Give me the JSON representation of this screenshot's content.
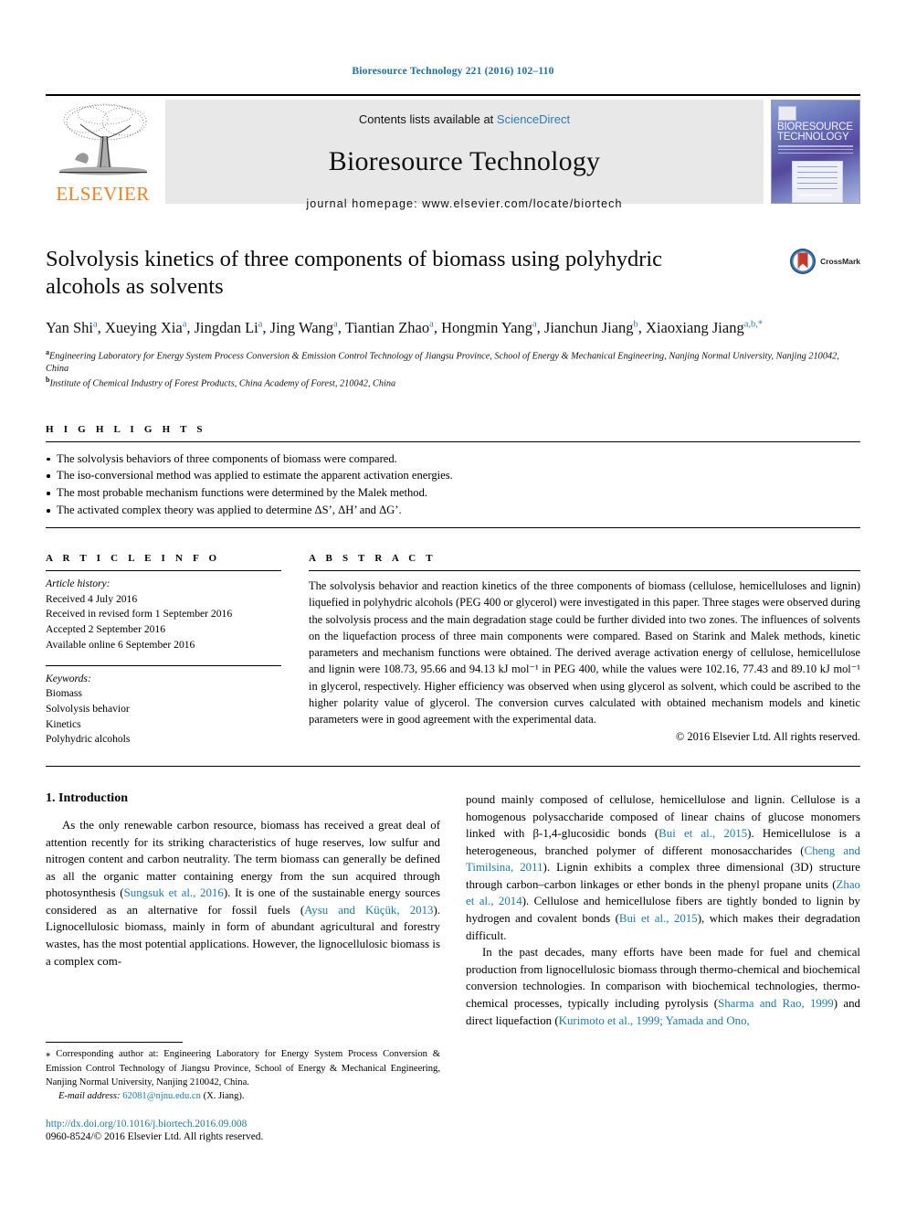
{
  "running_head": "Bioresource Technology 221 (2016) 102–110",
  "masthead": {
    "publisher": "ELSEVIER",
    "contents_prefix": "Contents lists available at ",
    "contents_link": "ScienceDirect",
    "journal_name": "Bioresource Technology",
    "homepage": "journal homepage: www.elsevier.com/locate/biortech",
    "cover_title_line1": "BIORESOURCE",
    "cover_title_line2": "TECHNOLOGY"
  },
  "article": {
    "title": "Solvolysis kinetics of three components of biomass using polyhydric alcohols as solvents",
    "crossmark_label": "CrossMark",
    "authors": [
      {
        "name": "Yan Shi",
        "sup": "a",
        "sep": ", "
      },
      {
        "name": "Xueying Xia",
        "sup": "a",
        "sep": ", "
      },
      {
        "name": "Jingdan Li",
        "sup": "a",
        "sep": ", "
      },
      {
        "name": "Jing Wang",
        "sup": "a",
        "sep": ", "
      },
      {
        "name": "Tiantian Zhao",
        "sup": "a",
        "sep": ", "
      },
      {
        "name": "Hongmin Yang",
        "sup": "a",
        "sep": ", "
      },
      {
        "name": "Jianchun Jiang",
        "sup": "b",
        "sep": ", "
      },
      {
        "name": "Xiaoxiang Jiang",
        "sup": "a,b,*",
        "sep": ""
      }
    ],
    "affiliations": [
      {
        "mark": "a",
        "text": "Engineering Laboratory for Energy System Process Conversion & Emission Control Technology of Jiangsu Province, School of Energy & Mechanical Engineering, Nanjing Normal University, Nanjing 210042, China"
      },
      {
        "mark": "b",
        "text": "Institute of Chemical Industry of Forest Products, China Academy of Forest, 210042, China"
      }
    ]
  },
  "highlights": {
    "heading": "H I G H L I G H T S",
    "items": [
      "The solvolysis behaviors of three components of biomass were compared.",
      "The iso-conversional method was applied to estimate the apparent activation energies.",
      "The most probable mechanism functions were determined by the Malek method.",
      "The activated complex theory was applied to determine ΔS’, ΔH’ and ΔG’."
    ]
  },
  "article_info": {
    "heading": "A R T I C L E   I N F O",
    "history_label": "Article history:",
    "history": [
      "Received 4 July 2016",
      "Received in revised form 1 September 2016",
      "Accepted 2 September 2016",
      "Available online 6 September 2016"
    ],
    "keywords_label": "Keywords:",
    "keywords": [
      "Biomass",
      "Solvolysis behavior",
      "Kinetics",
      "Polyhydric alcohols"
    ]
  },
  "abstract": {
    "heading": "A B S T R A C T",
    "text": "The solvolysis behavior and reaction kinetics of the three components of biomass (cellulose, hemicelluloses and lignin) liquefied in polyhydric alcohols (PEG 400 or glycerol) were investigated in this paper. Three stages were observed during the solvolysis process and the main degradation stage could be further divided into two zones. The influences of solvents on the liquefaction process of three main components were compared. Based on Starink and Malek methods, kinetic parameters and mechanism functions were obtained. The derived average activation energy of cellulose, hemicellulose and lignin were 108.73, 95.66 and 94.13 kJ mol⁻¹ in PEG 400, while the values were 102.16, 77.43 and 89.10 kJ mol⁻¹ in glycerol, respectively. Higher efficiency was observed when using glycerol as solvent, which could be ascribed to the higher polarity value of glycerol. The conversion curves calculated with obtained mechanism models and kinetic parameters were in good agreement with the experimental data.",
    "copyright": "© 2016 Elsevier Ltd. All rights reserved."
  },
  "body": {
    "section_title": "1. Introduction",
    "left_paragraph_html": "As the only renewable carbon resource, biomass has received a great deal of attention recently for its striking characteristics of huge reserves, low sulfur and nitrogen content and carbon neutrality. The term biomass can generally be defined as all the organic matter containing energy from the sun acquired through photosynthesis (<span class=\"ref\">Sungsuk et al., 2016</span>). It is one of the sustainable energy sources considered as an alternative for fossil fuels (<span class=\"ref\">Aysu and Küçük, 2013</span>). Lignocellulosic biomass, mainly in form of abundant agricultural and forestry wastes, has the most potential applications. However, the lignocellulosic biomass is a complex com-",
    "right_paragraph1_html": "pound mainly composed of cellulose, hemicellulose and lignin. Cellulose is a homogenous polysaccharide composed of linear chains of glucose monomers linked with β-1,4-glucosidic bonds (<span class=\"ref\">Bui et al., 2015</span>). Hemicellulose is a heterogeneous, branched polymer of different monosaccharides (<span class=\"ref\">Cheng and Timilsina, 2011</span>). Lignin exhibits a complex three dimensional (3D) structure through carbon–carbon linkages or ether bonds in the phenyl propane units (<span class=\"ref\">Zhao et al., 2014</span>). Cellulose and hemicellulose fibers are tightly bonded to lignin by hydrogen and covalent bonds (<span class=\"ref\">Bui et al., 2015</span>), which makes their degradation difficult.",
    "right_paragraph2_html": "In the past decades, many efforts have been made for fuel and chemical production from lignocellulosic biomass through thermo-chemical and biochemical conversion technologies. In comparison with biochemical technologies, thermo-chemical processes, typically including pyrolysis (<span class=\"ref\">Sharma and Rao, 1999</span>) and direct liquefaction (<span class=\"ref\">Kurimoto et al., 1999; Yamada and Ono,</span>"
  },
  "footnote": {
    "corresponding_html": "<span class=\"star\">⁎</span> Corresponding author at: Engineering Laboratory for Energy System Process Conversion &amp; Emission Control Technology of Jiangsu Province, School of Energy &amp; Mechanical Engineering, Nanjing Normal University, Nanjing 210042, China.",
    "email_label": "E-mail address:",
    "email": "62081@njnu.edu.cn",
    "email_suffix": "(X. Jiang).",
    "doi": "http://dx.doi.org/10.1016/j.biortech.2016.09.008",
    "issn": "0960-8524/© 2016 Elsevier Ltd. All rights reserved."
  },
  "colors": {
    "link_blue": "#1a7aae",
    "elsevier_orange": "#F08022",
    "band_gray": "#e8e8e8"
  }
}
